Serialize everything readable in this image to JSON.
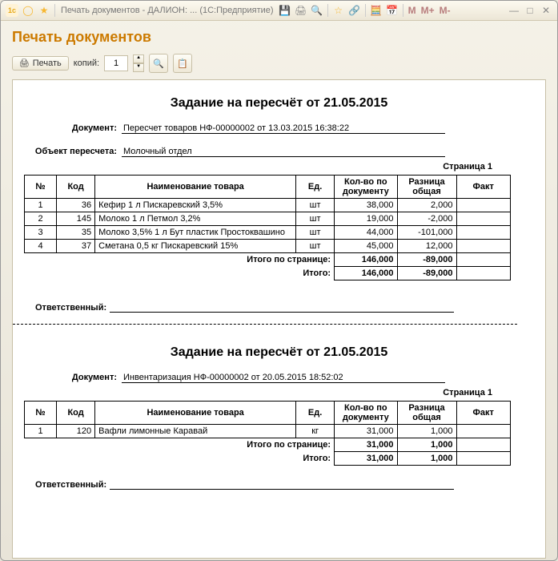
{
  "window": {
    "title": "Печать документов - ДАЛИОН: ...   (1С:Предприятие)",
    "m1": "M",
    "m2": "M+",
    "m3": "M-"
  },
  "header": {
    "title": "Печать документов"
  },
  "toolbar": {
    "print_label": "Печать",
    "copies_label": "копий:",
    "copies_value": "1"
  },
  "docs": [
    {
      "title": "Задание на пересчёт от 21.05.2015",
      "doc_label": "Документ:",
      "doc_value": "Пересчет товаров НФ-00000002 от 13.03.2015 16:38:22",
      "object_label": "Объект пересчета:",
      "object_value": "Молочный отдел",
      "page_label": "Страница 1",
      "headers": {
        "num": "№",
        "code": "Код",
        "name": "Наименование товара",
        "unit": "Ед.",
        "qty": "Кол-во по документу",
        "diff": "Разница общая",
        "fact": "Факт"
      },
      "rows": [
        {
          "num": "1",
          "code": "36",
          "name": "Кефир 1 л  Пискаревский 3,5%",
          "unit": "шт",
          "qty": "38,000",
          "diff": "2,000"
        },
        {
          "num": "2",
          "code": "145",
          "name": "Молоко 1 л   Петмол 3,2%",
          "unit": "шт",
          "qty": "19,000",
          "diff": "-2,000"
        },
        {
          "num": "3",
          "code": "35",
          "name": "Молоко 3,5% 1 л Бут пластик Простоквашино",
          "unit": "шт",
          "qty": "44,000",
          "diff": "-101,000"
        },
        {
          "num": "4",
          "code": "37",
          "name": "Сметана 0,5 кг  Пискаревский 15%",
          "unit": "шт",
          "qty": "45,000",
          "diff": "12,000"
        }
      ],
      "page_total_label": "Итого по странице:",
      "page_total_qty": "146,000",
      "page_total_diff": "-89,000",
      "grand_total_label": "Итого:",
      "grand_total_qty": "146,000",
      "grand_total_diff": "-89,000",
      "responsible_label": "Ответственный:"
    },
    {
      "title": "Задание на пересчёт от 21.05.2015",
      "doc_label": "Документ:",
      "doc_value": "Инвентаризация НФ-00000002 от 20.05.2015 18:52:02",
      "page_label": "Страница 1",
      "headers": {
        "num": "№",
        "code": "Код",
        "name": "Наименование товара",
        "unit": "Ед.",
        "qty": "Кол-во по документу",
        "diff": "Разница общая",
        "fact": "Факт"
      },
      "rows": [
        {
          "num": "1",
          "code": "120",
          "name": "Вафли лимонные Каравай",
          "unit": "кг",
          "qty": "31,000",
          "diff": "1,000"
        }
      ],
      "page_total_label": "Итого по странице:",
      "page_total_qty": "31,000",
      "page_total_diff": "1,000",
      "grand_total_label": "Итого:",
      "grand_total_qty": "31,000",
      "grand_total_diff": "1,000",
      "responsible_label": "Ответственный:"
    }
  ]
}
